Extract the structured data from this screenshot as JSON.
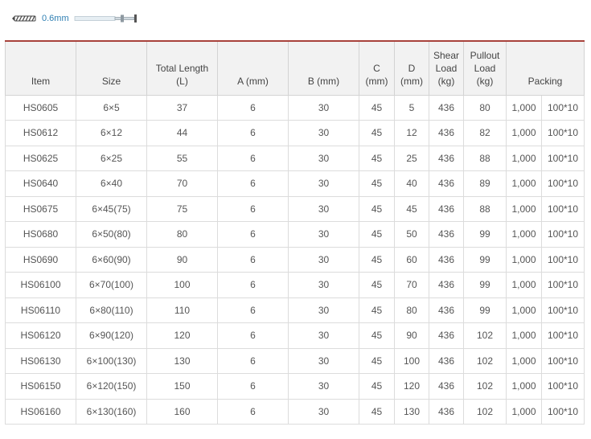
{
  "header": {
    "thickness_label": "0.6mm",
    "icon": "screw-anchor-icon"
  },
  "table": {
    "columns": {
      "item": "Item",
      "size": "Size",
      "total_length": "Total Length (L)",
      "a": "A (mm)",
      "b": "B (mm)",
      "c": "C (mm)",
      "d": "D (mm)",
      "shear": "Shear Load (kg)",
      "pullout": "Pullout Load (kg)",
      "packing": "Packing"
    },
    "rows": [
      {
        "item": "HS0605",
        "size": "6×5",
        "length": "37",
        "a": "6",
        "b": "30",
        "c": "45",
        "d": "5",
        "shear": "436",
        "pullout": "80",
        "pack_qty": "1,000",
        "pack_box": "100*10"
      },
      {
        "item": "HS0612",
        "size": "6×12",
        "length": "44",
        "a": "6",
        "b": "30",
        "c": "45",
        "d": "12",
        "shear": "436",
        "pullout": "82",
        "pack_qty": "1,000",
        "pack_box": "100*10"
      },
      {
        "item": "HS0625",
        "size": "6×25",
        "length": "55",
        "a": "6",
        "b": "30",
        "c": "45",
        "d": "25",
        "shear": "436",
        "pullout": "88",
        "pack_qty": "1,000",
        "pack_box": "100*10"
      },
      {
        "item": "HS0640",
        "size": "6×40",
        "length": "70",
        "a": "6",
        "b": "30",
        "c": "45",
        "d": "40",
        "shear": "436",
        "pullout": "89",
        "pack_qty": "1,000",
        "pack_box": "100*10"
      },
      {
        "item": "HS0675",
        "size": "6×45(75)",
        "length": "75",
        "a": "6",
        "b": "30",
        "c": "45",
        "d": "45",
        "shear": "436",
        "pullout": "88",
        "pack_qty": "1,000",
        "pack_box": "100*10"
      },
      {
        "item": "HS0680",
        "size": "6×50(80)",
        "length": "80",
        "a": "6",
        "b": "30",
        "c": "45",
        "d": "50",
        "shear": "436",
        "pullout": "99",
        "pack_qty": "1,000",
        "pack_box": "100*10"
      },
      {
        "item": "HS0690",
        "size": "6×60(90)",
        "length": "90",
        "a": "6",
        "b": "30",
        "c": "45",
        "d": "60",
        "shear": "436",
        "pullout": "99",
        "pack_qty": "1,000",
        "pack_box": "100*10"
      },
      {
        "item": "HS06100",
        "size": "6×70(100)",
        "length": "100",
        "a": "6",
        "b": "30",
        "c": "45",
        "d": "70",
        "shear": "436",
        "pullout": "99",
        "pack_qty": "1,000",
        "pack_box": "100*10"
      },
      {
        "item": "HS06110",
        "size": "6×80(110)",
        "length": "110",
        "a": "6",
        "b": "30",
        "c": "45",
        "d": "80",
        "shear": "436",
        "pullout": "99",
        "pack_qty": "1,000",
        "pack_box": "100*10"
      },
      {
        "item": "HS06120",
        "size": "6×90(120)",
        "length": "120",
        "a": "6",
        "b": "30",
        "c": "45",
        "d": "90",
        "shear": "436",
        "pullout": "102",
        "pack_qty": "1,000",
        "pack_box": "100*10"
      },
      {
        "item": "HS06130",
        "size": "6×100(130)",
        "length": "130",
        "a": "6",
        "b": "30",
        "c": "45",
        "d": "100",
        "shear": "436",
        "pullout": "102",
        "pack_qty": "1,000",
        "pack_box": "100*10"
      },
      {
        "item": "HS06150",
        "size": "6×120(150)",
        "length": "150",
        "a": "6",
        "b": "30",
        "c": "45",
        "d": "120",
        "shear": "436",
        "pullout": "102",
        "pack_qty": "1,000",
        "pack_box": "100*10"
      },
      {
        "item": "HS06160",
        "size": "6×130(160)",
        "length": "160",
        "a": "6",
        "b": "30",
        "c": "45",
        "d": "130",
        "shear": "436",
        "pullout": "102",
        "pack_qty": "1,000",
        "pack_box": "100*10"
      }
    ]
  },
  "colors": {
    "header_rule": "#a8423c",
    "header_bg": "#f2f2f2",
    "accent_text": "#2f7fb3"
  }
}
